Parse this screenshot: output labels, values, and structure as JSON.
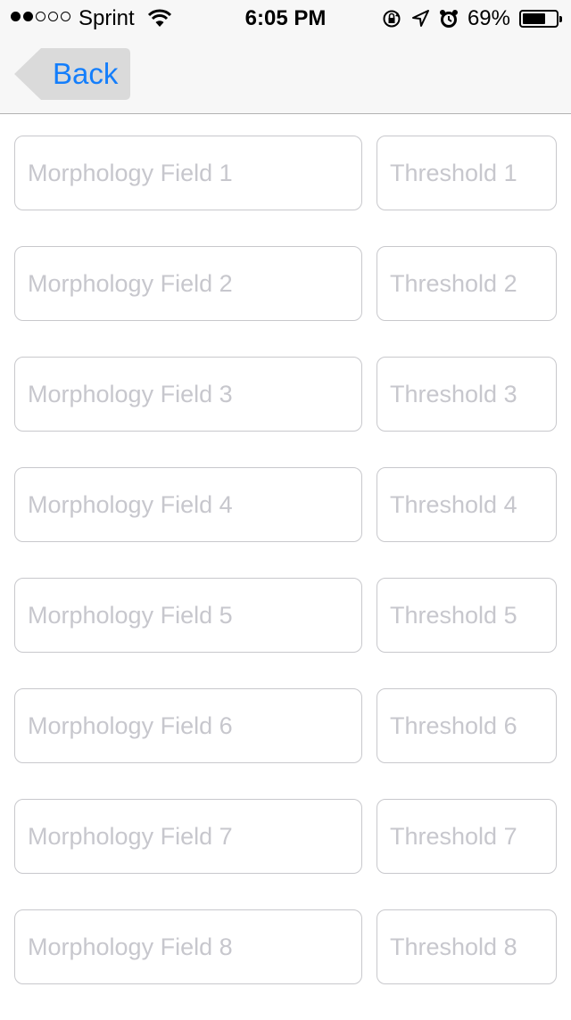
{
  "status_bar": {
    "carrier": "Sprint",
    "signal_bars_filled": 2,
    "signal_bars_total": 5,
    "time": "6:05 PM",
    "battery_percent_label": "69%",
    "battery_level": 0.69,
    "icons": [
      "wifi-icon",
      "rotation-lock-icon",
      "location-arrow-icon",
      "alarm-icon",
      "battery-icon"
    ]
  },
  "nav": {
    "back_label": "Back"
  },
  "colors": {
    "accent": "#147efb",
    "placeholder": "#c7c7cd",
    "field_border": "#c8c8cc",
    "nav_background": "#f7f7f7",
    "back_button_background": "#dadada"
  },
  "fields": [
    {
      "morphology_placeholder": "Morphology Field 1",
      "morphology_value": "",
      "threshold_placeholder": "Threshold 1",
      "threshold_value": ""
    },
    {
      "morphology_placeholder": "Morphology Field 2",
      "morphology_value": "",
      "threshold_placeholder": "Threshold 2",
      "threshold_value": ""
    },
    {
      "morphology_placeholder": "Morphology Field 3",
      "morphology_value": "",
      "threshold_placeholder": "Threshold 3",
      "threshold_value": ""
    },
    {
      "morphology_placeholder": "Morphology Field 4",
      "morphology_value": "",
      "threshold_placeholder": "Threshold 4",
      "threshold_value": ""
    },
    {
      "morphology_placeholder": "Morphology Field 5",
      "morphology_value": "",
      "threshold_placeholder": "Threshold 5",
      "threshold_value": ""
    },
    {
      "morphology_placeholder": "Morphology Field 6",
      "morphology_value": "",
      "threshold_placeholder": "Threshold 6",
      "threshold_value": ""
    },
    {
      "morphology_placeholder": "Morphology Field 7",
      "morphology_value": "",
      "threshold_placeholder": "Threshold 7",
      "threshold_value": ""
    },
    {
      "morphology_placeholder": "Morphology Field 8",
      "morphology_value": "",
      "threshold_placeholder": "Threshold 8",
      "threshold_value": ""
    }
  ]
}
